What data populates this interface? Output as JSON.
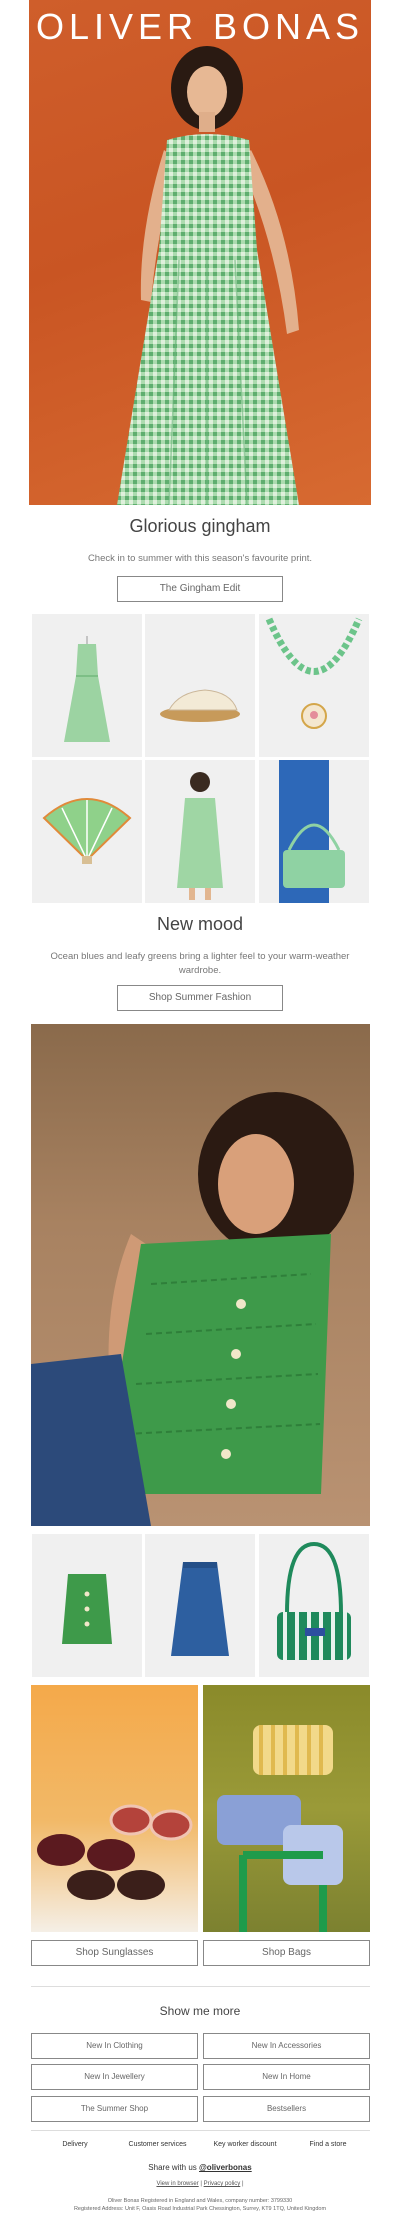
{
  "brand": "OLIVER BONAS",
  "section1": {
    "title": "Glorious gingham",
    "subtitle": "Check in to summer with this season's favourite print.",
    "button": "The Gingham Edit"
  },
  "section2": {
    "title": "New mood",
    "subtitle": "Ocean blues and leafy greens bring a lighter feel to your warm-weather wardrobe.",
    "button": "Shop Summer Fashion"
  },
  "split": {
    "left_button": "Shop Sunglasses",
    "right_button": "Shop Bags"
  },
  "more": {
    "title": "Show me more",
    "links": [
      "New In Clothing",
      "New In Accessories",
      "New In Jewellery",
      "New In Home",
      "The Summer Shop",
      "Bestsellers"
    ]
  },
  "footer": {
    "links": [
      "Delivery",
      "Customer services",
      "Key worker discount",
      "Find a store"
    ],
    "share_prefix": "Share with us",
    "share_handle": "@oliverbonas",
    "view_in_browser": "View in browser",
    "separator": "|",
    "privacy": "Privacy policy",
    "legal1": "Oliver Bonas Registered in England and Wales, company number: 3799330",
    "legal2": "Registered Address: Unit F, Oasis Road Industrial Park Chessington, Surrey, KT9 1TQ, United Kingdom"
  },
  "colors": {
    "hero_bg": "#cf5e2b",
    "gingham": "#7fc48e",
    "knit_green": "#3e9a4a",
    "denim": "#2d5fa0"
  }
}
